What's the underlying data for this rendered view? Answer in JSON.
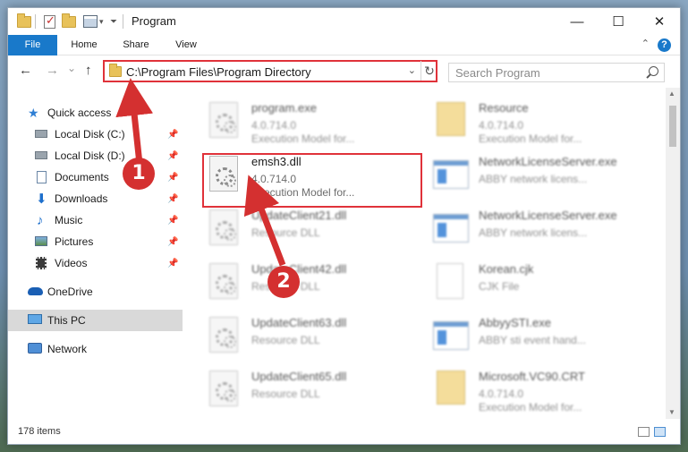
{
  "window": {
    "title": "Program",
    "minimize": "—",
    "maximize": "☐",
    "close": "✕"
  },
  "ribbon": {
    "tabs": [
      "File",
      "Home",
      "Share",
      "View"
    ],
    "help": "?",
    "collapse": "⌃"
  },
  "nav": {
    "back": "←",
    "forward": "→",
    "recent": "⌄",
    "up": "↑",
    "address": "C:\\Program Files\\Program Directory",
    "dropdown": "⌄",
    "refresh": "↻",
    "search_placeholder": "Search Program"
  },
  "sidebar": {
    "items": [
      {
        "label": "Quick access",
        "icon": "star-icon",
        "pinned": false
      },
      {
        "label": "Local Disk (C:)",
        "icon": "drive-icon",
        "pinned": true
      },
      {
        "label": "Local Disk (D:)",
        "icon": "drive-icon",
        "pinned": true
      },
      {
        "label": "Documents",
        "icon": "documents-icon",
        "pinned": true
      },
      {
        "label": "Downloads",
        "icon": "download-icon",
        "pinned": true
      },
      {
        "label": "Music",
        "icon": "music-icon",
        "pinned": true
      },
      {
        "label": "Pictures",
        "icon": "pictures-icon",
        "pinned": true
      },
      {
        "label": "Videos",
        "icon": "videos-icon",
        "pinned": true
      },
      {
        "label": "OneDrive",
        "icon": "cloud-icon",
        "pinned": false
      },
      {
        "label": "This PC",
        "icon": "computer-icon",
        "pinned": false,
        "selected": true
      },
      {
        "label": "Network",
        "icon": "network-icon",
        "pinned": false
      }
    ],
    "pin_glyph": "📌"
  },
  "files": [
    {
      "name": "program.exe",
      "line1": "4.0.714.0",
      "line2": "Execution Model for...",
      "icon": "exe-gear-icon",
      "blurred": true
    },
    {
      "name": "Resource",
      "line1": "4.0.714.0",
      "line2": "Execution Model for...",
      "icon": "folder-icon",
      "blurred": true
    },
    {
      "name": "emsh3.dll",
      "line1": "4.0.714.0",
      "line2": "Execution Model for...",
      "icon": "dll-icon",
      "blurred": false
    },
    {
      "name": "NetworkLicenseServer.exe",
      "line1": "ABBY network licens...",
      "line2": "",
      "icon": "exe-icon",
      "blurred": true
    },
    {
      "name": "UpdateClient21.dll",
      "line1": "Resource DLL",
      "line2": "",
      "icon": "dll-icon",
      "blurred": true
    },
    {
      "name": "NetworkLicenseServer.exe",
      "line1": "ABBY network licens...",
      "line2": "",
      "icon": "exe-icon",
      "blurred": true
    },
    {
      "name": "UpdateClient42.dll",
      "line1": "Resource DLL",
      "line2": "",
      "icon": "dll-icon",
      "blurred": true
    },
    {
      "name": "Korean.cjk",
      "line1": "CJK File",
      "line2": "",
      "icon": "blank-file-icon",
      "blurred": true
    },
    {
      "name": "UpdateClient63.dll",
      "line1": "Resource DLL",
      "line2": "",
      "icon": "dll-icon",
      "blurred": true
    },
    {
      "name": "AbbyySTI.exe",
      "line1": "ABBY sti event hand...",
      "line2": "",
      "icon": "exe-icon",
      "blurred": true
    },
    {
      "name": "UpdateClient65.dll",
      "line1": "Resource DLL",
      "line2": "",
      "icon": "dll-icon",
      "blurred": true
    },
    {
      "name": "Microsoft.VC90.CRT",
      "line1": "4.0.714.0",
      "line2": "Execution Model for...",
      "icon": "folder-icon",
      "blurred": true
    }
  ],
  "status": {
    "count": "178 items"
  },
  "annotations": {
    "step1": "1",
    "step2": "2",
    "color": "#d43030"
  }
}
